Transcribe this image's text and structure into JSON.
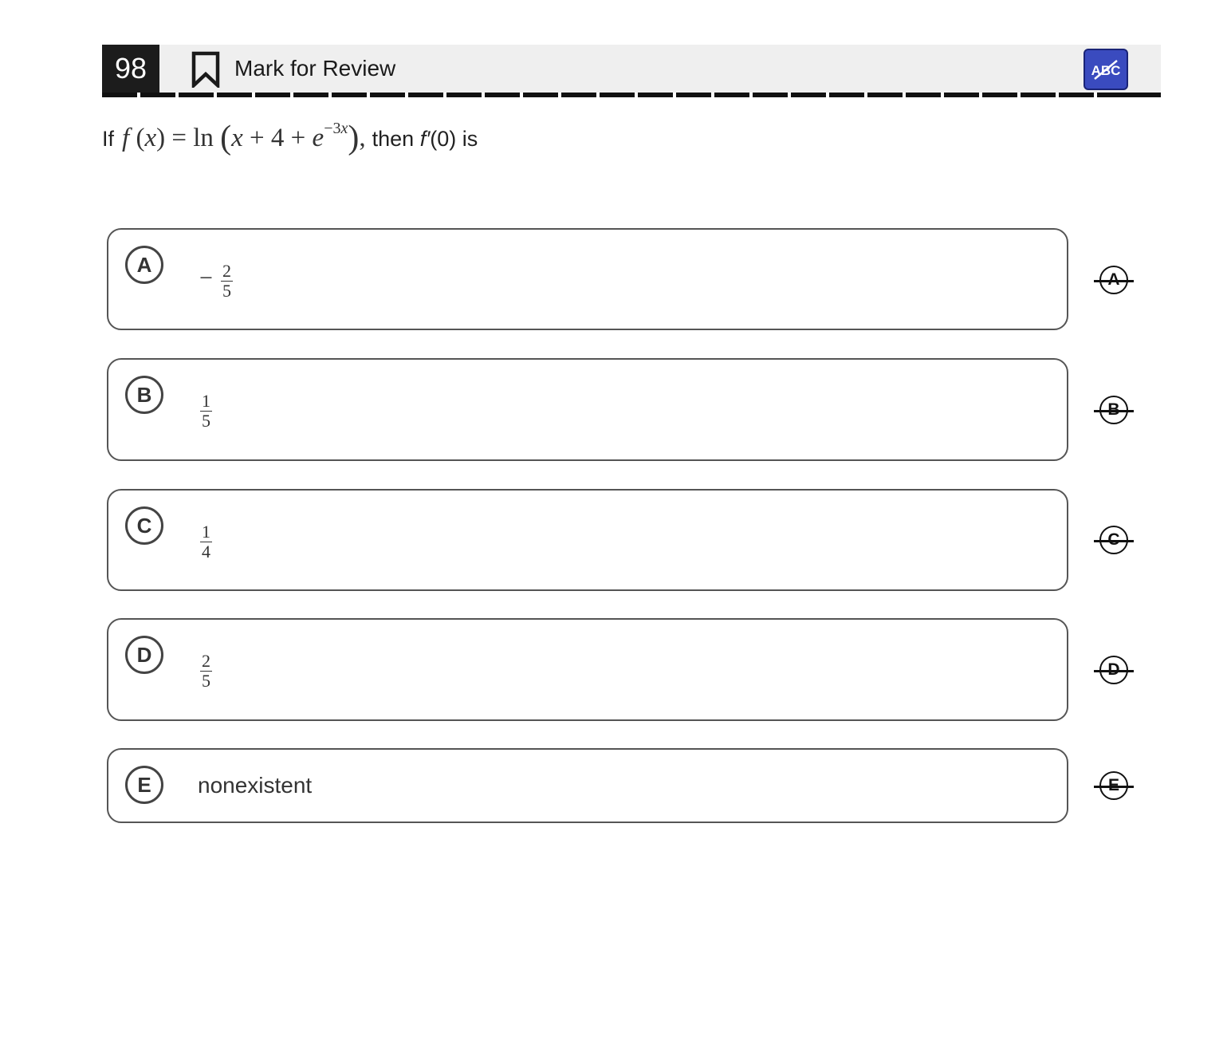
{
  "header": {
    "question_number": "98",
    "mark_for_review_label": "Mark for Review",
    "tool_label": "ABC",
    "accent_color": "#3a4bbf"
  },
  "question": {
    "prefix": "If",
    "math": {
      "f": "f",
      "x": "x",
      "eq": "=",
      "ln": "ln",
      "plus": "+",
      "four": "4",
      "e": "e",
      "exponent": "−3",
      "comma": ","
    },
    "suffix_then": "then",
    "fprime": "f′",
    "suffix_end": "(0) is"
  },
  "choices": [
    {
      "letter": "A",
      "sign": "−",
      "numerator": "2",
      "denominator": "5"
    },
    {
      "letter": "B",
      "numerator": "1",
      "denominator": "5"
    },
    {
      "letter": "C",
      "numerator": "1",
      "denominator": "4"
    },
    {
      "letter": "D",
      "numerator": "2",
      "denominator": "5"
    },
    {
      "letter": "E",
      "text": "nonexistent"
    }
  ]
}
